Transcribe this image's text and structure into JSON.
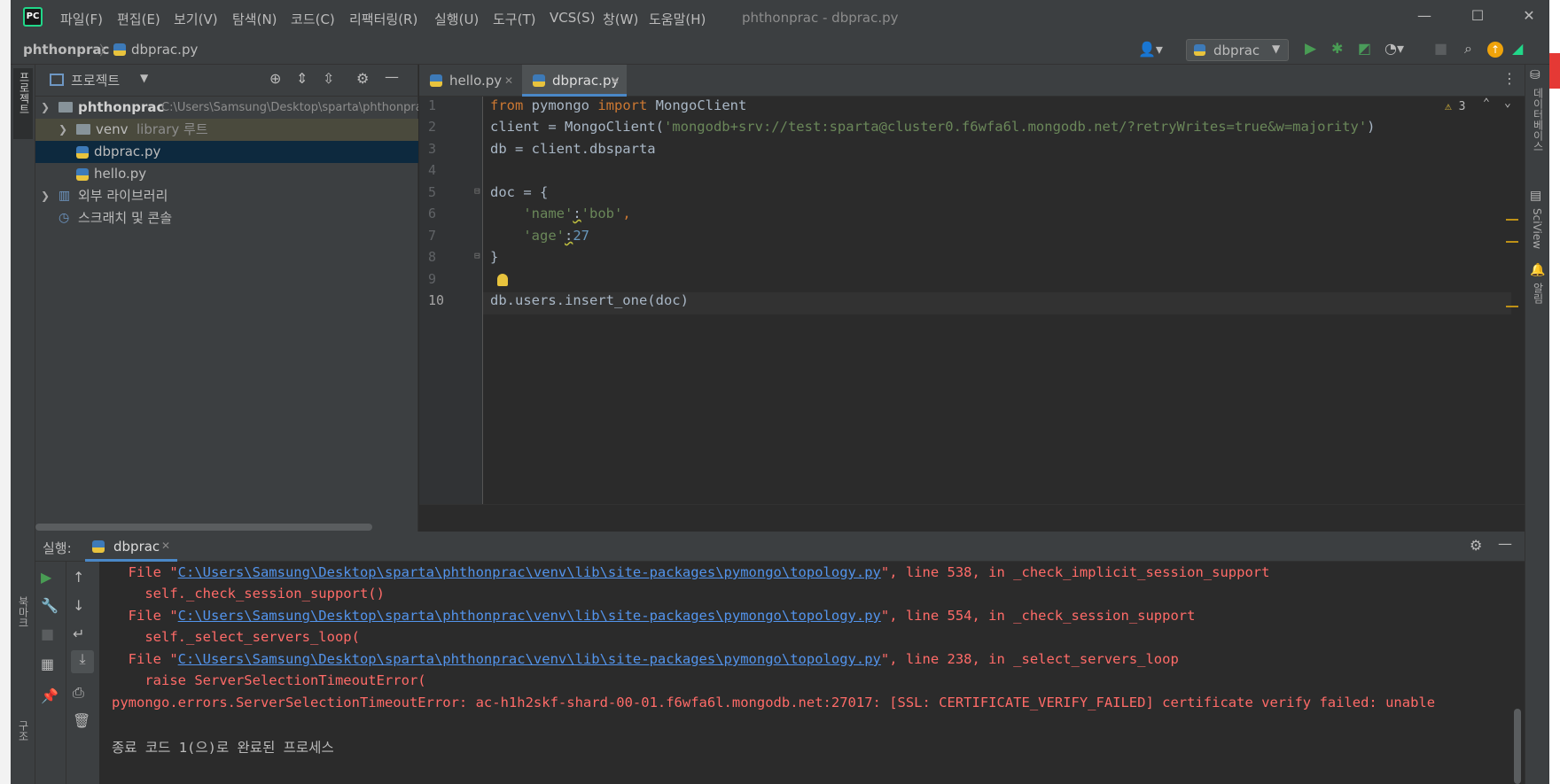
{
  "window": {
    "title": "phthonprac - dbprac.py",
    "menu": [
      "파일(F)",
      "편집(E)",
      "보기(V)",
      "탐색(N)",
      "코드(C)",
      "리팩터링(R)",
      "실행(U)",
      "도구(T)",
      "VCS(S)",
      "창(W)",
      "도움말(H)"
    ]
  },
  "navbar": {
    "project": "phthonprac",
    "file": "dbprac.py",
    "run_config": "dbprac"
  },
  "left_strip": {
    "project_label": "프로젝트",
    "bookmarks_label": "북마크",
    "structure_label": "구조"
  },
  "right_strip": {
    "database_label": "데이터베이스",
    "sciview_label": "SciView",
    "notifications_label": "알림"
  },
  "project_panel": {
    "title": "프로젝트",
    "tree": [
      {
        "name": "phthonprac",
        "hint": "C:\\Users\\Samsung\\Desktop\\sparta\\phthonprac"
      },
      {
        "name": "venv",
        "hint": "library 루트"
      },
      {
        "name": "dbprac.py",
        "hint": ""
      },
      {
        "name": "hello.py",
        "hint": ""
      },
      {
        "name": "외부 라이브러리",
        "hint": ""
      },
      {
        "name": "스크래치 및 콘솔",
        "hint": ""
      }
    ]
  },
  "editor": {
    "tabs": [
      {
        "label": "hello.py",
        "active": false
      },
      {
        "label": "dbprac.py",
        "active": true
      }
    ],
    "warnings_count": "3",
    "lines": [
      "1",
      "2",
      "3",
      "4",
      "5",
      "6",
      "7",
      "8",
      "9",
      "10"
    ],
    "code": {
      "l1_from": "from",
      "l1_mod": " pymongo ",
      "l1_import": "import",
      "l1_rest": " MongoClient",
      "l2_pre": "client = MongoClient(",
      "l2_str": "'mongodb+srv://test:sparta@cluster0.f6wfa6l.mongodb.net/?retryWrites=true&w=majority'",
      "l2_post": ")",
      "l3": "db = client.dbsparta",
      "l5": "doc = {",
      "l6_key": "'name'",
      "l6_colon": ":",
      "l6_val": "'bob'",
      "l6_comma": ",",
      "l7_key": "'age'",
      "l7_colon": ":",
      "l7_val": "27",
      "l8": "}",
      "l10": "db.users.insert_one(doc)"
    }
  },
  "run_panel": {
    "label": "실행:",
    "tab": "dbprac",
    "output": [
      {
        "pre": "  File \"",
        "link": "C:\\Users\\Samsung\\Desktop\\sparta\\phthonprac\\venv\\lib\\site-packages\\pymongo\\topology.py",
        "post": "\", line 538, in _check_implicit_session_support"
      },
      {
        "text": "    self._check_session_support()"
      },
      {
        "pre": "  File \"",
        "link": "C:\\Users\\Samsung\\Desktop\\sparta\\phthonprac\\venv\\lib\\site-packages\\pymongo\\topology.py",
        "post": "\", line 554, in _check_session_support"
      },
      {
        "text": "    self._select_servers_loop("
      },
      {
        "pre": "  File \"",
        "link": "C:\\Users\\Samsung\\Desktop\\sparta\\phthonprac\\venv\\lib\\site-packages\\pymongo\\topology.py",
        "post": "\", line 238, in _select_servers_loop"
      },
      {
        "text": "    raise ServerSelectionTimeoutError("
      },
      {
        "text": "pymongo.errors.ServerSelectionTimeoutError: ac-h1h2skf-shard-00-01.f6wfa6l.mongodb.net:27017: [SSL: CERTIFICATE_VERIFY_FAILED] certificate verify failed: unable"
      }
    ],
    "exit_message": "종료 코드 1(으)로 완료된 프로세스"
  },
  "colors": {
    "accent_run": "#499c54",
    "error": "#ff6b68",
    "link": "#5394ec"
  }
}
